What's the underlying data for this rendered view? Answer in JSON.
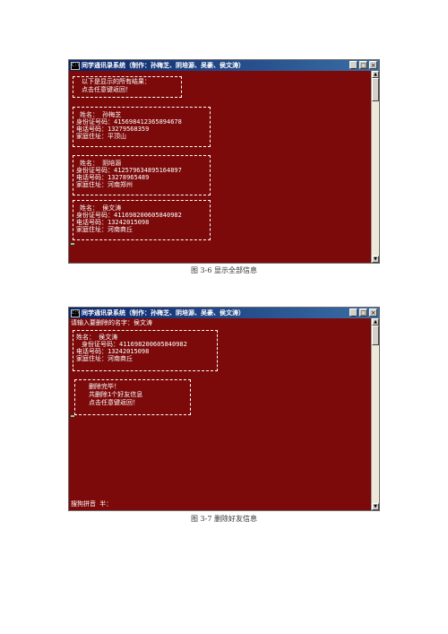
{
  "window1": {
    "title": "同学通讯录系统（制作：孙梅芝、阴培源、吴豪、侯文涛）",
    "header_lines": [
      "以下是显示的所有结果：",
      "点击任意键返回！"
    ],
    "records": [
      {
        "name": "姓名：  孙梅芝",
        "id": "身份证号码：415698412365894678",
        "phone": "电话号码：13279568359",
        "address": "家庭住址：平顶山"
      },
      {
        "name": "姓名：  阴培源",
        "id": "身份证号码：412579634895164897",
        "phone": "电话号码：13278965489",
        "address": "家庭住址：河南郑州"
      },
      {
        "name": "姓名：  侯文涛",
        "id": "身份证号码：411698200605840982",
        "phone": "电话号码：13242015098",
        "address": "家庭住址：河南商丘"
      }
    ],
    "caption": "图 3-6      显示全部信息"
  },
  "window2": {
    "title": "同学通讯录系统（制作：孙梅芝、阴培源、吴豪、侯文涛）",
    "prompt": "请输入要删除的名字：侯文涛",
    "record": {
      "name": "姓名：  侯文涛",
      "id": "身份证号码：411698200605840982",
      "phone": "电话号码：13242015098",
      "address": "家庭住址：河南商丘"
    },
    "result_lines": [
      "删除完毕！",
      "共删除1个好友信息",
      "点击任意键返回！"
    ],
    "ime": "搜狗拼音 半：",
    "caption": "图 3-7      删除好友信息"
  },
  "window_buttons": {
    "minimize": "_",
    "maximize": "□",
    "close": "×"
  },
  "icons": {
    "app": "console-app-icon",
    "up": "scroll-up-icon",
    "down": "scroll-down-icon"
  }
}
